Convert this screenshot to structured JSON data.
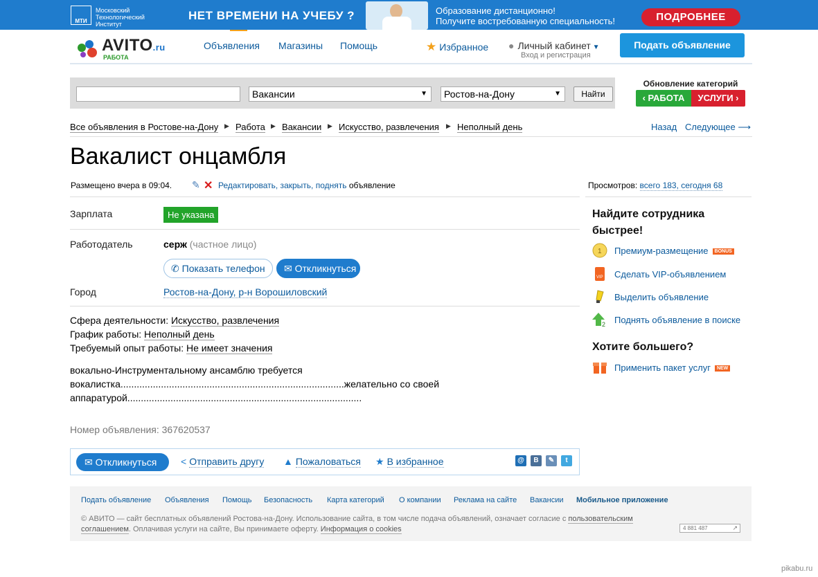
{
  "banner": {
    "logo_badge": "МТИ",
    "logo_title": "Московский Технологический Институт",
    "slogan": "НЕТ ВРЕМЕНИ НА УЧЕБУ ?",
    "text_line1": "Образование дистанционно!",
    "text_line2": "Получите востребованную специальность!",
    "button": "ПОДРОБНЕЕ"
  },
  "header": {
    "brand": "AVITO",
    "brand_tld": ".ru",
    "brand_sub": "РАБОТА",
    "nav": [
      "Объявления",
      "Магазины",
      "Помощь"
    ],
    "favorites": "Избранное",
    "cabinet": "Личный кабинет",
    "cabinet_sub": "Вход и регистрация",
    "post_button": "Подать объявление"
  },
  "search": {
    "query": "",
    "category": "Вакансии",
    "city": "Ростов-на-Дону",
    "button": "Найти"
  },
  "category_update": {
    "title": "Обновление категорий",
    "left": "‹ РАБОТА",
    "right": "УСЛУГИ ›"
  },
  "breadcrumbs": [
    "Все объявления в Ростове-на-Дону",
    "Работа",
    "Вакансии",
    "Искусство, развлечения",
    "Неполный день"
  ],
  "pager": {
    "back": "Назад",
    "next": "Следующее ⟶"
  },
  "ad": {
    "title": "Вакалист онцамбля",
    "posted": "Размещено вчера в 09:04.",
    "edit_link": "Редактировать, закрыть, поднять",
    "edit_suffix": " объявление",
    "views_label": "Просмотров: ",
    "views_value": "всего 183, сегодня 68",
    "salary_label": "Зарплата",
    "salary_value": "Не указана",
    "employer_label": "Работодатель",
    "employer_name": "серж",
    "employer_type": " (частное лицо)",
    "show_phone": "Показать телефон",
    "reply": "Откликнуться",
    "city_label": "Город",
    "city_value": "Ростов-на-Дону, р-н Ворошиловский",
    "sphere_label": "Сфера деятельности: ",
    "sphere_value": "Искусство, развлечения",
    "schedule_label": "График работы: ",
    "schedule_value": "Неполный день",
    "experience_label": "Требуемый опыт работы: ",
    "experience_value": "Не имеет значения",
    "description": "вокально-Инструментальному ансамблю требуется\nвокалистка...................................................................................желательно со своей\nаппаратурой.......................................................................................",
    "number": "Номер объявления: 367620537"
  },
  "actions": {
    "reply": "Откликнуться",
    "send": "Отправить другу",
    "complain": "Пожаловаться",
    "favorite": "В избранное",
    "social": [
      "@",
      "В",
      "✎",
      "t"
    ]
  },
  "sidebar": {
    "heading1": "Найдите сотрудника быстрее!",
    "items": [
      {
        "label": "Премиум-размещение",
        "tag": "BONUS"
      },
      {
        "label": "Сделать VIP-объявлением"
      },
      {
        "label": "Выделить объявление"
      },
      {
        "label": "Поднять объявление в поиске"
      }
    ],
    "heading2": "Хотите большего?",
    "package": {
      "label": "Применить пакет услуг",
      "tag": "NEW"
    }
  },
  "footer": {
    "links": [
      "Подать объявление",
      "Объявления",
      "Помощь",
      "Безопасность",
      "Карта категорий",
      "О компании",
      "Реклама на сайте",
      "Вакансии",
      "Мобильное приложение"
    ],
    "copy_1": "© АВИТО — сайт бесплатных объявлений Ростова-на-Дону. Использование сайта, в том числе подача объявлений, означает согласие с ",
    "copy_link1": "пользовательским соглашением",
    "copy_2": ". Оплачивая услуги на сайте, Вы принимаете оферту. ",
    "copy_link2": "Информация о cookies",
    "counter": "4 881 487"
  },
  "watermark": "pikabu.ru",
  "colors": {
    "accent": "#1f7ccd",
    "link": "#0b5a9c",
    "salary_badge": "#22a42a",
    "banner_button": "#d8202e"
  }
}
